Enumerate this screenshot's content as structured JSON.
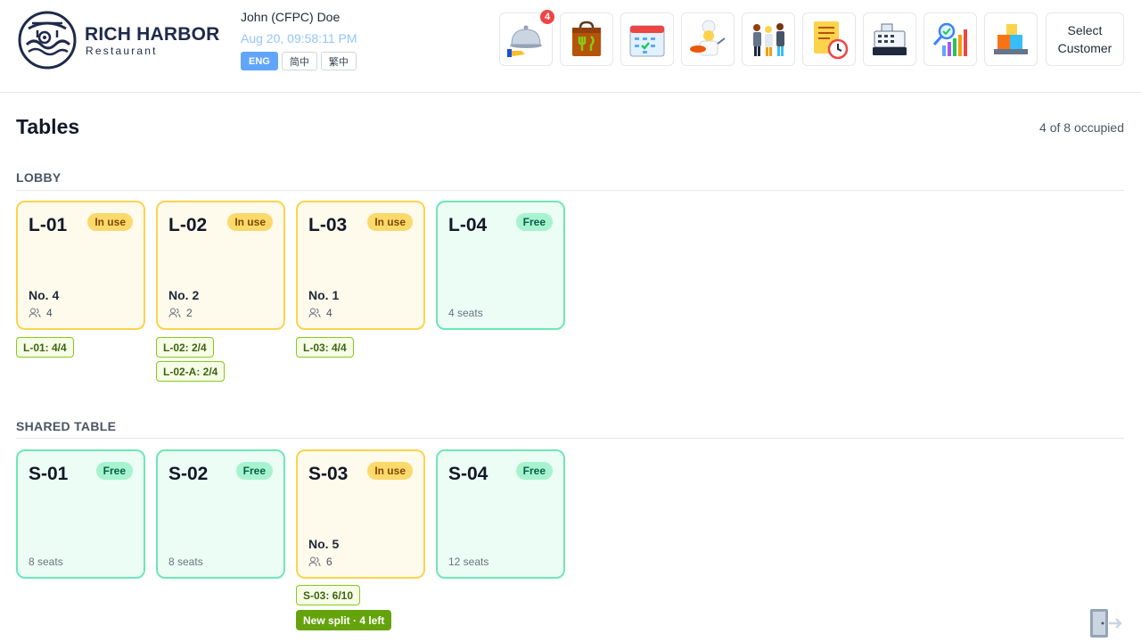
{
  "brand": {
    "name": "RICH HARBOR",
    "sub": "Restaurant"
  },
  "user": {
    "name": "John (CFPC) Doe",
    "datetime": "Aug 20, 09:58:11 PM"
  },
  "languages": [
    {
      "label": "ENG",
      "active": true
    },
    {
      "label": "简中",
      "active": false
    },
    {
      "label": "繁中",
      "active": false
    }
  ],
  "toolbar": {
    "orders_badge": "4",
    "select_customer": "Select Customer",
    "icons": [
      "service-bell-icon",
      "takeaway-bag-icon",
      "calendar-icon",
      "chef-icon",
      "staff-icon",
      "receipt-clock-icon",
      "cash-register-icon",
      "analytics-icon",
      "inventory-boxes-icon"
    ]
  },
  "page": {
    "title": "Tables",
    "occupied": "4 of 8 occupied"
  },
  "sections": {
    "lobby": {
      "title": "LOBBY",
      "tables": [
        {
          "name": "L-01",
          "status": "In use",
          "order": "No. 4",
          "guests": "4",
          "chips": [
            "L-01: 4/4"
          ]
        },
        {
          "name": "L-02",
          "status": "In use",
          "order": "No. 2",
          "guests": "2",
          "chips": [
            "L-02: 2/4",
            "L-02-A: 2/4"
          ]
        },
        {
          "name": "L-03",
          "status": "In use",
          "order": "No. 1",
          "guests": "4",
          "chips": [
            "L-03: 4/4"
          ]
        },
        {
          "name": "L-04",
          "status": "Free",
          "seats": "4 seats"
        }
      ]
    },
    "shared": {
      "title": "SHARED TABLE",
      "tables": [
        {
          "name": "S-01",
          "status": "Free",
          "seats": "8 seats"
        },
        {
          "name": "S-02",
          "status": "Free",
          "seats": "8 seats"
        },
        {
          "name": "S-03",
          "status": "In use",
          "order": "No. 5",
          "guests": "6",
          "chips": [
            "S-03: 6/10"
          ],
          "split": "New split · 4 left"
        },
        {
          "name": "S-04",
          "status": "Free",
          "seats": "12 seats"
        }
      ]
    }
  },
  "colors": {
    "busy_border": "#fcd34d",
    "free_border": "#6ee7b7",
    "accent": "#60a5fa",
    "chip": "#84cc16"
  }
}
